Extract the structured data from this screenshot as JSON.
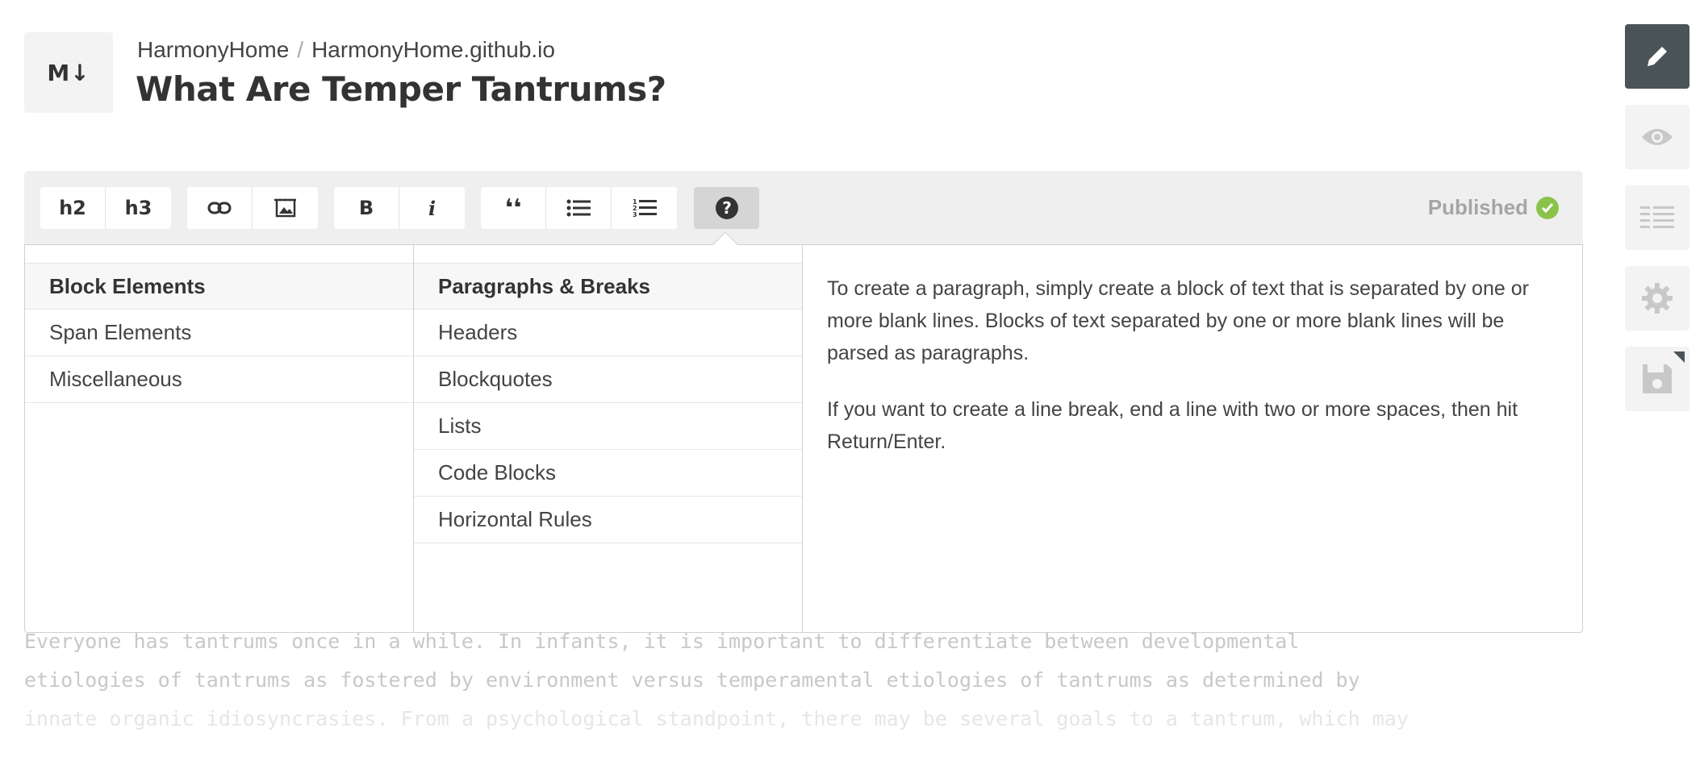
{
  "header": {
    "logo_text": "M↓",
    "breadcrumb": {
      "owner": "HarmonyHome",
      "separator": "/",
      "repo": "HarmonyHome.github.io"
    },
    "title": "What Are Temper Tantrums?"
  },
  "toolbar": {
    "buttons": {
      "h2": "h2",
      "h3": "h3",
      "link_icon": "link-icon",
      "image_icon": "image-icon",
      "bold": "B",
      "italic": "i",
      "quote": "❛❛",
      "ul_icon": "bulleted-list-icon",
      "ol_icon": "numbered-list-icon",
      "help_icon": "question-circle-icon"
    },
    "status": "Published"
  },
  "help": {
    "categories": [
      "Block Elements",
      "Span Elements",
      "Miscellaneous"
    ],
    "topics": [
      "Paragraphs & Breaks",
      "Headers",
      "Blockquotes",
      "Lists",
      "Code Blocks",
      "Horizontal Rules"
    ],
    "content": [
      "To create a paragraph, simply create a block of text that is separated by one or more blank lines. Blocks of text separated by one or more blank lines will be parsed as paragraphs.",
      "If you want to create a line break, end a line with two or more spaces, then hit Return/Enter."
    ]
  },
  "editor": {
    "lines": [
      "Everyone has tantrums once in a while. In infants, it is important to differentiate between developmental",
      "etiologies of tantrums as fostered by environment versus temperamental etiologies of tantrums as determined by",
      "innate organic idiosyncrasies. From a psychological standpoint, there may be several goals to a tantrum, which may"
    ]
  },
  "sidebar": {
    "items": [
      "edit-icon",
      "preview-icon",
      "meta-icon",
      "settings-icon",
      "save-icon"
    ]
  },
  "colors": {
    "accent_dark": "#4a5358",
    "published_green": "#8bc34a",
    "toolbar_bg": "#efefef"
  }
}
